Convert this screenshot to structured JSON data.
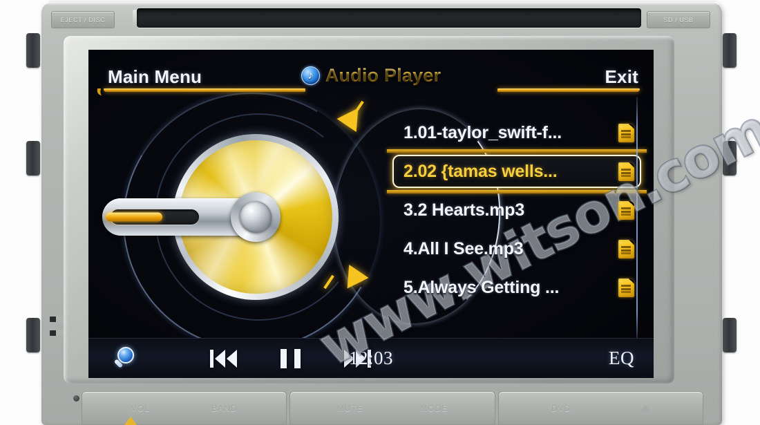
{
  "device": {
    "brand_watermark": "www.witson.com",
    "top_left_button_label": "EJECT  /  DISC",
    "top_right_button_label": "SD   /   USB",
    "bottom_buttons": [
      {
        "labels": [
          "VOL",
          "BAND"
        ]
      },
      {
        "labels": [
          "MUTE",
          "MODE"
        ]
      },
      {
        "labels": [
          "DVD",
          "OPEN"
        ]
      }
    ]
  },
  "header": {
    "main_menu_label": "Main Menu",
    "title": "Audio Player",
    "title_icon": "music-note-icon",
    "exit_label": "Exit"
  },
  "media": {
    "disc_icon": "cd-disc-graphic",
    "scroll_up_icon": "scroll-up-arrow-icon",
    "scroll_down_icon": "scroll-down-arrow-icon"
  },
  "playlist": {
    "selected_index": 1,
    "tracks": [
      {
        "label": "1.01-taylor_swift-f...",
        "icon": "mp3-file-icon",
        "selected": false
      },
      {
        "label": "2.02 {tamas wells...",
        "icon": "mp3-file-icon",
        "selected": true
      },
      {
        "label": "3.2 Hearts.mp3",
        "icon": "mp3-file-icon",
        "selected": false
      },
      {
        "label": "4.All I See.mp3",
        "icon": "mp3-file-icon",
        "selected": false
      },
      {
        "label": "5.Always Getting ...",
        "icon": "mp3-file-icon",
        "selected": false
      }
    ]
  },
  "controls": {
    "search_icon": "magnifier-icon",
    "previous_icon": "previous-track-icon",
    "pause_icon": "pause-icon",
    "next_icon": "next-track-icon",
    "clock": "12:03",
    "eq_label": "EQ"
  },
  "colors": {
    "accent_gold": "#f2c33c",
    "screen_background": "#05060a",
    "text_primary": "#f3f5f9",
    "selected_text": "#f7cf3e",
    "arc_blue": "#96afe1",
    "bezel_gray": "#b3b7b4"
  }
}
